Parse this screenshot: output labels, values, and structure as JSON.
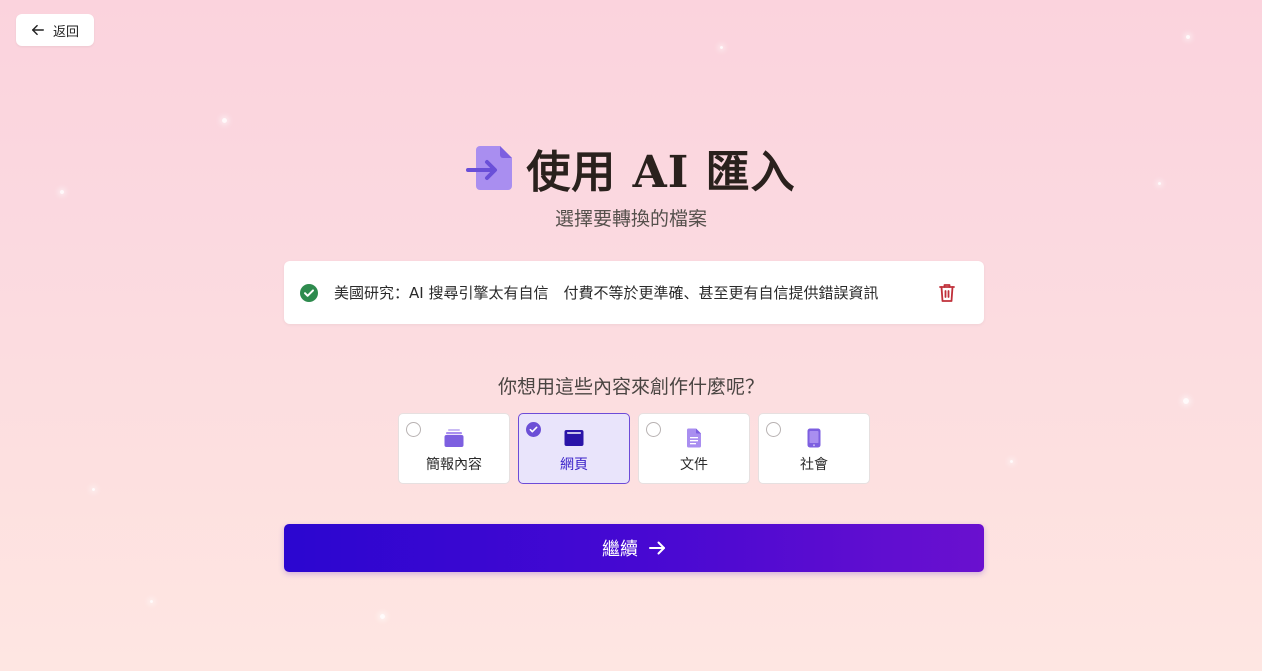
{
  "back_button": {
    "label": "返回"
  },
  "header": {
    "title": "使用 AI 匯入",
    "subtitle": "選擇要轉換的檔案"
  },
  "file": {
    "name": "美國研究：AI 搜尋引擎太有自信　付費不等於更準確、甚至更有自信提供錯誤資訊",
    "status": "uploaded"
  },
  "question": "你想用這些內容來創作什麼呢？",
  "options": [
    {
      "label": "簡報內容",
      "icon": "presentation-icon",
      "selected": false
    },
    {
      "label": "網頁",
      "icon": "webpage-icon",
      "selected": true
    },
    {
      "label": "文件",
      "icon": "document-icon",
      "selected": false
    },
    {
      "label": "社會",
      "icon": "phone-icon",
      "selected": false
    }
  ],
  "continue_button": {
    "label": "繼續"
  },
  "colors": {
    "accent": "#6c4fd6",
    "button_start": "#2b06d0",
    "button_end": "#6a10cf",
    "success": "#2e8b4e",
    "danger": "#c0303a"
  }
}
